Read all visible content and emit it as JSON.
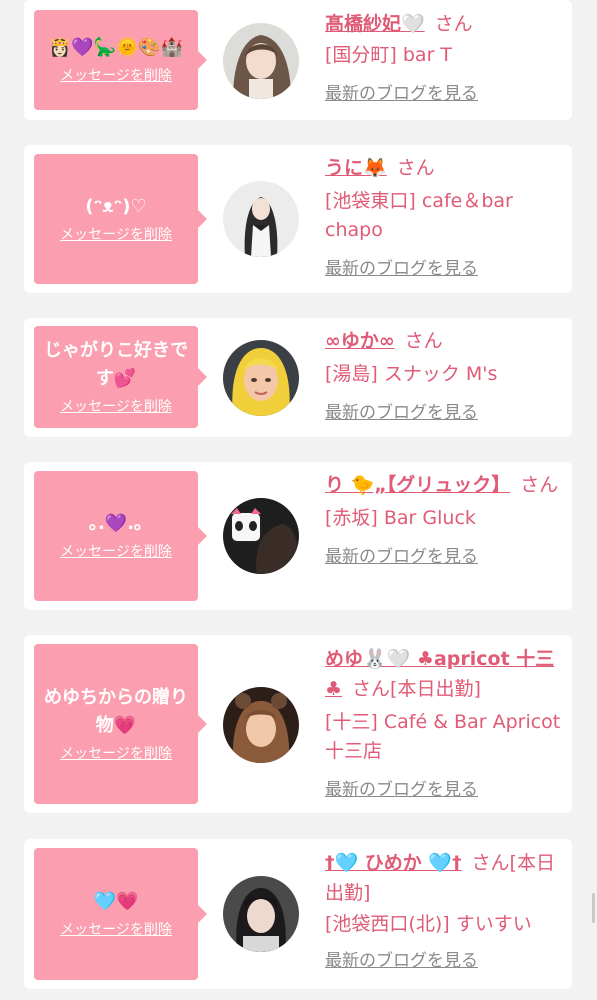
{
  "delete_label": "メッセージを削除",
  "blog_label": "最新のブログを見る",
  "honorific": "さん",
  "colors": {
    "bubble": "#fb9eaf",
    "accent": "#e05b76",
    "link_gray": "#8a8a8a",
    "background": "#f2f2f2"
  },
  "items": [
    {
      "message": "👸🏻💜🦕🌞🎨🏰",
      "name": "髙橋紗妃🤍",
      "suffix": "さん",
      "shop": "[国分町] bar T",
      "avatar": "girl-with-long-hair"
    },
    {
      "message": "(ᵔᴥᵔ)♡",
      "name": "うに🦊",
      "suffix": "さん",
      "shop": "[池袋東口] cafe＆bar chapo",
      "avatar": "girl-in-dress"
    },
    {
      "message": "じゃがりこ好きです💕",
      "name": "∞ゆか∞",
      "suffix": "さん",
      "shop": "[湯島] スナック M's",
      "avatar": "3d-avatar-blonde"
    },
    {
      "message": "｡.💜.｡",
      "name": "り 🐤„【グリュック】",
      "suffix": "さん",
      "shop": "[赤坂] Bar Gluck",
      "avatar": "girl-with-panda-sticker"
    },
    {
      "message": "めゆちからの贈り物💗",
      "name": "めゆ🐰🤍 ♣apricot 十三♣",
      "suffix": "さん[本日出勤]",
      "shop": "[十三] Café & Bar Apricot 十三店",
      "avatar": "girl-with-bear-ears"
    },
    {
      "message": "🩵💗",
      "name": "†🩵 ひめか 🩵†",
      "suffix": "さん[本日出勤]",
      "shop": "[池袋西口(北)] すいすい",
      "avatar": "girl-dark-hair"
    }
  ]
}
